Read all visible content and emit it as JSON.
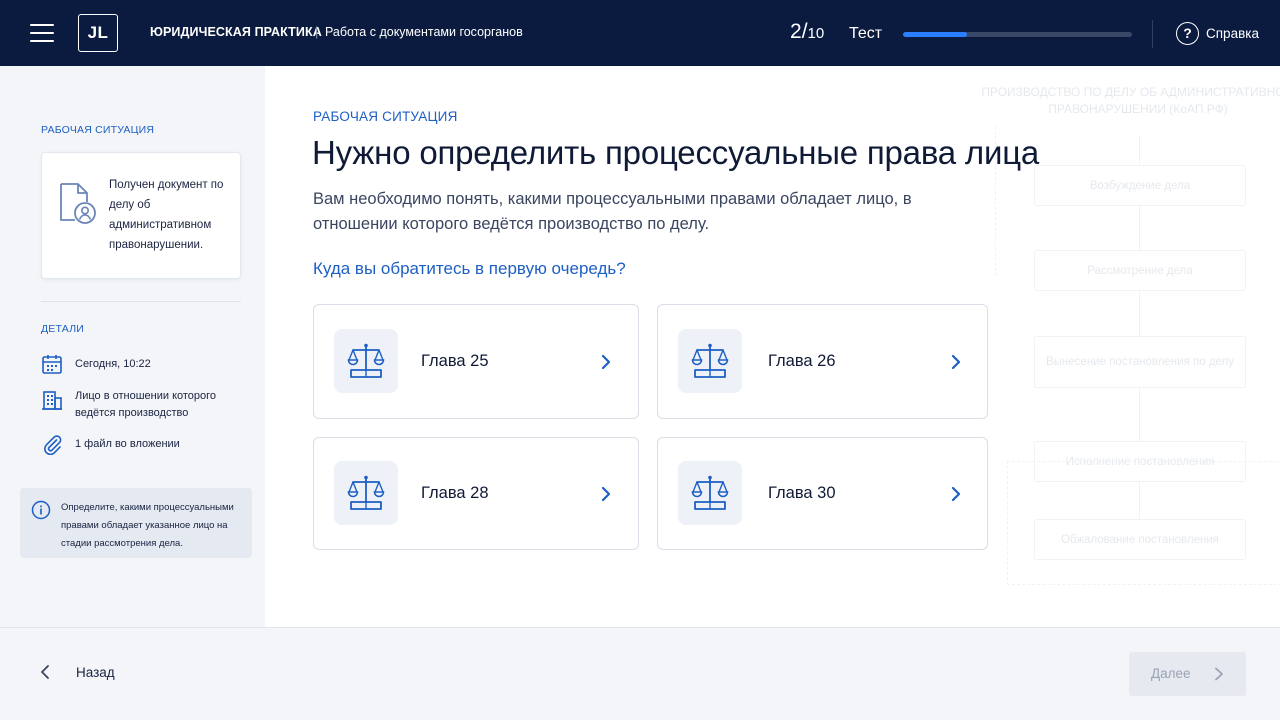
{
  "header": {
    "logo": "JL",
    "brand": "ЮРИДИЧЕСКАЯ ПРАКТИКА",
    "separator": "|",
    "section": "Работа с документами госорганов",
    "counter_current": "2",
    "counter_slash": "/",
    "counter_total": "10",
    "mode": "Тест",
    "progress_fraction": 0.28,
    "help_label": "Справка",
    "help_icon": "?"
  },
  "sidebar": {
    "situation_heading": "РАБОЧАЯ СИТУАЦИЯ",
    "situation_text": "Получен документ по делу об административном правонарушении.",
    "details_heading": "ДЕТАЛИ",
    "details": [
      {
        "icon": "calendar-icon",
        "text": "Сегодня, 10:22"
      },
      {
        "icon": "building-icon",
        "text": "Лицо в отношении которого ведётся производство"
      },
      {
        "icon": "paperclip-icon",
        "text": "1 файл во вложении"
      }
    ],
    "info_text": "Определите, какими процессуальными правами обладает указанное лицо на стадии рассмотрения дела."
  },
  "main": {
    "eyebrow": "РАБОЧАЯ СИТУАЦИЯ",
    "title": "Нужно определить процессуальные права лица",
    "lead": "Вам необходимо понять, какими процессуальными правами обладает лицо, в отношении которого ведётся производство по делу.",
    "question": "Куда вы обратитесь в первую очередь?",
    "options": [
      {
        "label": "Глава 25",
        "icon": "scales-icon"
      },
      {
        "label": "Глава 26",
        "icon": "scales-icon"
      },
      {
        "label": "Глава 28",
        "icon": "scales-icon"
      },
      {
        "label": "Глава 30",
        "icon": "scales-icon"
      }
    ]
  },
  "flowchart": {
    "title": "ПРОИЗВОДСТВО ПО ДЕЛУ ОБ АДМИНИСТРАТИВНОМ ПРАВОНАРУШЕНИИ (КоАП РФ)",
    "steps": [
      "Возбуждение дела",
      "Рассмотрение дела",
      "Вынесение постановления по делу",
      "Исполнение постановления",
      "Обжалование постановления"
    ]
  },
  "footer": {
    "back_label": "Назад",
    "next_label": "Далее"
  },
  "colors": {
    "header_bg": "#0b1b3f",
    "accent": "#1d5fc4",
    "progress_fill": "#2a7fff",
    "sidebar_bg": "#f3f5f9",
    "disabled_button_bg": "#e6e9ef"
  }
}
